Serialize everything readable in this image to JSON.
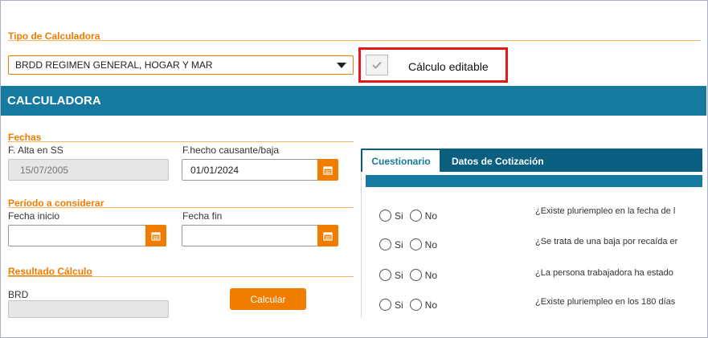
{
  "tipo": {
    "title": "Tipo de Calculadora",
    "selected": "BRDD REGIMEN GENERAL, HOGAR Y MAR",
    "editable_label": "Cálculo editable"
  },
  "calculadora": {
    "title": "CALCULADORA"
  },
  "fechas": {
    "title": "Fechas",
    "alta_label": "F. Alta en SS",
    "alta_value": "15/07/2005",
    "hecho_label": "F.hecho causante/baja",
    "hecho_value": "01/01/2024"
  },
  "periodo": {
    "title": "Período a considerar",
    "inicio_label": "Fecha inicio",
    "inicio_value": "",
    "fin_label": "Fecha fin",
    "fin_value": ""
  },
  "resultado": {
    "title": "Resultado Cálculo",
    "brd_label": "BRD",
    "brd_value": "",
    "calcular_label": "Calcular"
  },
  "tabs": [
    {
      "label": "Cuestionario"
    },
    {
      "label": "Datos de Cotización"
    }
  ],
  "options": {
    "si": "Si",
    "no": "No"
  },
  "questions": [
    "¿Existe pluriempleo en la fecha de l",
    "¿Se trata de una baja por recaída er",
    "¿La persona trabajadora ha estado",
    "¿Existe pluriempleo en los 180 días"
  ],
  "colors": {
    "accent": "#f07c00",
    "banner": "#167aa0",
    "tab_dark": "#0a5f80",
    "highlight": "#e51919"
  },
  "icons": {
    "calendar": "calendar-icon",
    "dropdown": "chevron-down-icon",
    "check": "check-icon"
  }
}
